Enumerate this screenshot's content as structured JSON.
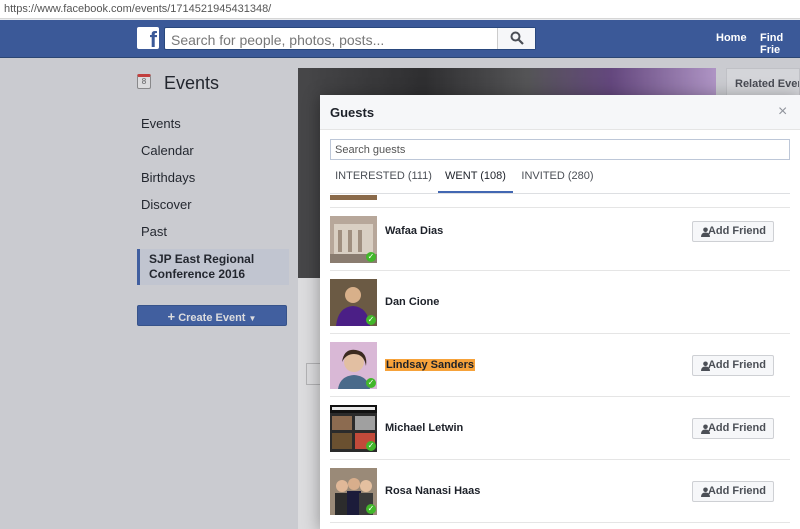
{
  "browser": {
    "url": "https://www.facebook.com/events/1714521945431348/"
  },
  "topbar": {
    "logo": "f",
    "search_placeholder": "Search for people, photos, posts...",
    "home": "Home",
    "find_friends": "Find Frie"
  },
  "left_nav": {
    "title": "Events",
    "calendar_day": "8",
    "items": [
      {
        "label": "Events"
      },
      {
        "label": "Calendar"
      },
      {
        "label": "Birthdays"
      },
      {
        "label": "Discover"
      },
      {
        "label": "Past"
      }
    ],
    "active_event": "SJP East Regional Conference 2016",
    "create_event": "Create Event"
  },
  "right": {
    "related_events": "Related Events"
  },
  "modal": {
    "title": "Guests",
    "close": "×",
    "search_placeholder": "Search guests",
    "tabs": [
      {
        "label": "INTERESTED (111)"
      },
      {
        "label": "WENT (108)"
      },
      {
        "label": "INVITED (280)"
      }
    ],
    "active_tab": "WENT (108)",
    "guests": [
      {
        "name": "Wafaa Dias",
        "has_add_friend": true,
        "highlighted": false
      },
      {
        "name": "Dan Cione",
        "has_add_friend": false,
        "highlighted": false
      },
      {
        "name": "Lindsay Sanders",
        "has_add_friend": true,
        "highlighted": true
      },
      {
        "name": "Michael Letwin",
        "has_add_friend": true,
        "highlighted": false
      },
      {
        "name": "Rosa Nanasi Haas",
        "has_add_friend": true,
        "highlighted": false
      }
    ],
    "add_friend_label": "Add Friend"
  },
  "colors": {
    "fb_blue": "#3b5998",
    "button_blue": "#4267b2",
    "highlight": "#f6a23a",
    "went_check": "#42b72a"
  }
}
